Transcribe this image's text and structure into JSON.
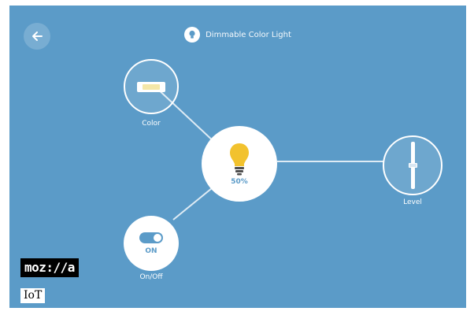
{
  "header": {
    "title": "Dimmable Color Light",
    "back_icon": "arrow-left-icon",
    "title_icon": "lightbulb-icon"
  },
  "center": {
    "level": "50%",
    "icon": "lightbulb-icon"
  },
  "properties": {
    "color": {
      "label": "Color",
      "icon": "color-swatch-icon",
      "swatch": "#f4e7a8"
    },
    "level": {
      "label": "Level",
      "icon": "slider-icon",
      "value_fraction": 0.5
    },
    "onoff": {
      "label": "On/Off",
      "state": "ON",
      "icon": "toggle-icon"
    }
  },
  "branding": {
    "logo": "moz://a",
    "sub": "IoT"
  },
  "colors": {
    "background": "#5b9bc8",
    "bulb": "#f2c22e",
    "accent": "#5b9bc8"
  }
}
